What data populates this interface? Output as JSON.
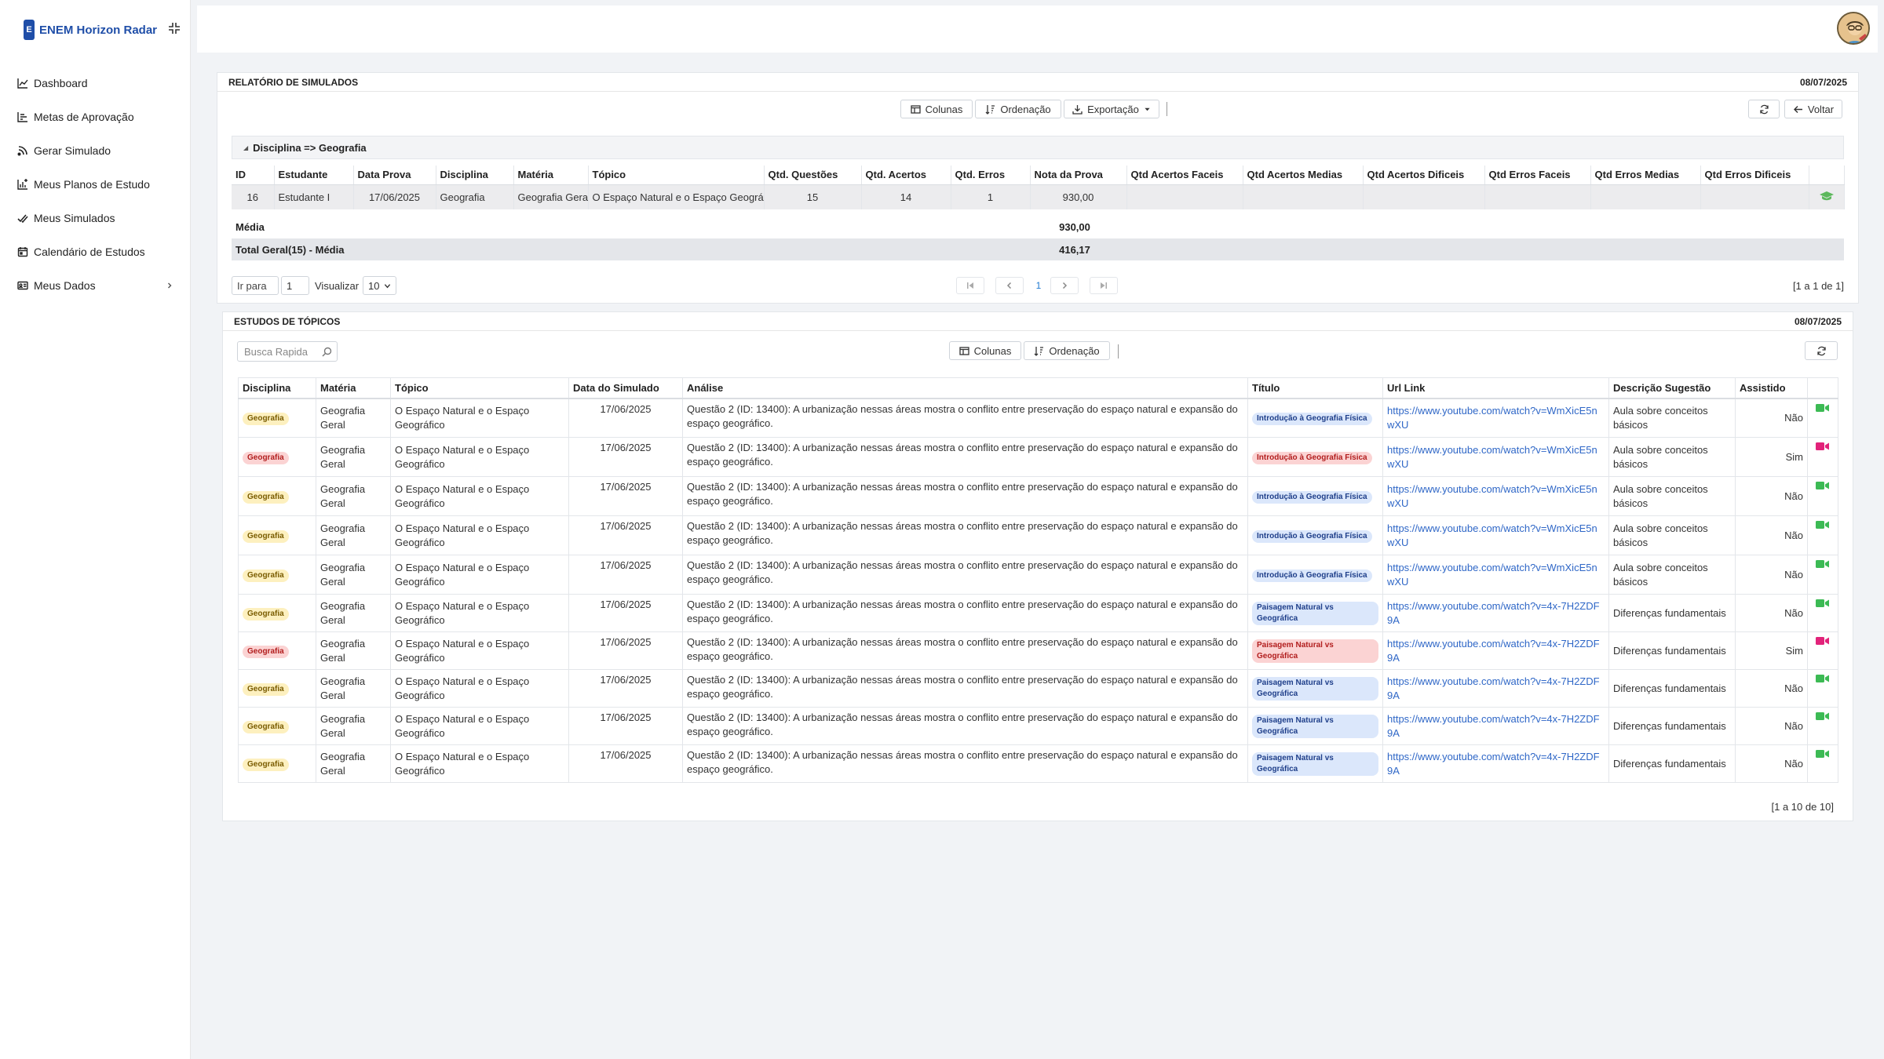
{
  "brand": {
    "badge": "E",
    "name": "ENEM Horizon Radar"
  },
  "nav": [
    {
      "label": "Dashboard",
      "icon": "line-chart-icon"
    },
    {
      "label": "Metas de Aprovação",
      "icon": "bar-chart-icon"
    },
    {
      "label": "Gerar Simulado",
      "icon": "rss-icon"
    },
    {
      "label": "Meus Planos de Estudo",
      "icon": "chart-plan-icon"
    },
    {
      "label": "Meus Simulados",
      "icon": "check-double-icon"
    },
    {
      "label": "Calendário de Estudos",
      "icon": "calendar-icon"
    },
    {
      "label": "Meus Dados",
      "icon": "id-card-icon"
    }
  ],
  "report": {
    "title": "RELATÓRIO DE SIMULADOS",
    "date": "08/07/2025",
    "buttons": {
      "columns": "Colunas",
      "order": "Ordenação",
      "export": "Exportação",
      "back": "Voltar"
    },
    "group_label": "Disciplina => Geografia",
    "columns": [
      "ID",
      "Estudante",
      "Data Prova",
      "Disciplina",
      "Matéria",
      "Tópico",
      "Qtd. Questões",
      "Qtd. Acertos",
      "Qtd. Erros",
      "Nota da Prova",
      "Qtd Acertos Faceis",
      "Qtd Acertos Medias",
      "Qtd Acertos Dificeis",
      "Qtd Erros Faceis",
      "Qtd Erros Medias",
      "Qtd Erros Dificeis"
    ],
    "row": {
      "id": "16",
      "student": "Estudante I",
      "date": "17/06/2025",
      "discipline": "Geografia",
      "subject": "Geografia Geral",
      "topic": "O Espaço Natural e o Espaço Geográfico",
      "questions": "15",
      "hits": "14",
      "errors": "1",
      "score": "930,00"
    },
    "avg_label": "Média",
    "avg_value": "930,00",
    "total_label": "Total Geral(15) - Média",
    "total_value": "416,17",
    "goto_label": "Ir para",
    "goto_value": "1",
    "view_label": "Visualizar",
    "view_value": "10",
    "current_page": "1",
    "range": "[1 a 1 de 1]"
  },
  "topics": {
    "title": "ESTUDOS DE TÓPICOS",
    "date": "08/07/2025",
    "search_placeholder": "Busca Rapida",
    "buttons": {
      "columns": "Colunas",
      "order": "Ordenação"
    },
    "columns": [
      "Disciplina",
      "Matéria",
      "Tópico",
      "Data do Simulado",
      "Análise",
      "Título",
      "Url Link",
      "Descrição Sugestão",
      "Assistido"
    ],
    "rows": [
      {
        "discipline": "Geografia",
        "d_color": "yellow",
        "subject": "Geografia Geral",
        "topic": "O Espaço Natural e o Espaço Geográfico",
        "date": "17/06/2025",
        "analysis": "Questão 2 (ID: 13400): A urbanização nessas áreas mostra o conflito entre preservação do espaço natural e expansão do espaço geográfico.",
        "title": "Introdução à Geografia Física",
        "t_color": "blue",
        "url": "https://www.youtube.com/watch?v=WmXicE5nwXU",
        "desc": "Aula sobre conceitos básicos",
        "watched": "Não",
        "cam": "green"
      },
      {
        "discipline": "Geografia",
        "d_color": "red",
        "subject": "Geografia Geral",
        "topic": "O Espaço Natural e o Espaço Geográfico",
        "date": "17/06/2025",
        "analysis": "Questão 2 (ID: 13400): A urbanização nessas áreas mostra o conflito entre preservação do espaço natural e expansão do espaço geográfico.",
        "title": "Introdução à Geografia Física",
        "t_color": "red",
        "url": "https://www.youtube.com/watch?v=WmXicE5nwXU",
        "desc": "Aula sobre conceitos básicos",
        "watched": "Sim",
        "cam": "pink"
      },
      {
        "discipline": "Geografia",
        "d_color": "yellow",
        "subject": "Geografia Geral",
        "topic": "O Espaço Natural e o Espaço Geográfico",
        "date": "17/06/2025",
        "analysis": "Questão 2 (ID: 13400): A urbanização nessas áreas mostra o conflito entre preservação do espaço natural e expansão do espaço geográfico.",
        "title": "Introdução à Geografia Física",
        "t_color": "blue",
        "url": "https://www.youtube.com/watch?v=WmXicE5nwXU",
        "desc": "Aula sobre conceitos básicos",
        "watched": "Não",
        "cam": "green"
      },
      {
        "discipline": "Geografia",
        "d_color": "yellow",
        "subject": "Geografia Geral",
        "topic": "O Espaço Natural e o Espaço Geográfico",
        "date": "17/06/2025",
        "analysis": "Questão 2 (ID: 13400): A urbanização nessas áreas mostra o conflito entre preservação do espaço natural e expansão do espaço geográfico.",
        "title": "Introdução à Geografia Física",
        "t_color": "blue",
        "url": "https://www.youtube.com/watch?v=WmXicE5nwXU",
        "desc": "Aula sobre conceitos básicos",
        "watched": "Não",
        "cam": "green"
      },
      {
        "discipline": "Geografia",
        "d_color": "yellow",
        "subject": "Geografia Geral",
        "topic": "O Espaço Natural e o Espaço Geográfico",
        "date": "17/06/2025",
        "analysis": "Questão 2 (ID: 13400): A urbanização nessas áreas mostra o conflito entre preservação do espaço natural e expansão do espaço geográfico.",
        "title": "Introdução à Geografia Física",
        "t_color": "blue",
        "url": "https://www.youtube.com/watch?v=WmXicE5nwXU",
        "desc": "Aula sobre conceitos básicos",
        "watched": "Não",
        "cam": "green"
      },
      {
        "discipline": "Geografia",
        "d_color": "yellow",
        "subject": "Geografia Geral",
        "topic": "O Espaço Natural e o Espaço Geográfico",
        "date": "17/06/2025",
        "analysis": "Questão 2 (ID: 13400): A urbanização nessas áreas mostra o conflito entre preservação do espaço natural e expansão do espaço geográfico.",
        "title": "Paisagem Natural vs Geográfica",
        "t_color": "blue",
        "url": "https://www.youtube.com/watch?v=4x-7H2ZDF9A",
        "desc": "Diferenças fundamentais",
        "watched": "Não",
        "cam": "green"
      },
      {
        "discipline": "Geografia",
        "d_color": "red",
        "subject": "Geografia Geral",
        "topic": "O Espaço Natural e o Espaço Geográfico",
        "date": "17/06/2025",
        "analysis": "Questão 2 (ID: 13400): A urbanização nessas áreas mostra o conflito entre preservação do espaço natural e expansão do espaço geográfico.",
        "title": "Paisagem Natural vs Geográfica",
        "t_color": "red",
        "url": "https://www.youtube.com/watch?v=4x-7H2ZDF9A",
        "desc": "Diferenças fundamentais",
        "watched": "Sim",
        "cam": "pink"
      },
      {
        "discipline": "Geografia",
        "d_color": "yellow",
        "subject": "Geografia Geral",
        "topic": "O Espaço Natural e o Espaço Geográfico",
        "date": "17/06/2025",
        "analysis": "Questão 2 (ID: 13400): A urbanização nessas áreas mostra o conflito entre preservação do espaço natural e expansão do espaço geográfico.",
        "title": "Paisagem Natural vs Geográfica",
        "t_color": "blue",
        "url": "https://www.youtube.com/watch?v=4x-7H2ZDF9A",
        "desc": "Diferenças fundamentais",
        "watched": "Não",
        "cam": "green"
      },
      {
        "discipline": "Geografia",
        "d_color": "yellow",
        "subject": "Geografia Geral",
        "topic": "O Espaço Natural e o Espaço Geográfico",
        "date": "17/06/2025",
        "analysis": "Questão 2 (ID: 13400): A urbanização nessas áreas mostra o conflito entre preservação do espaço natural e expansão do espaço geográfico.",
        "title": "Paisagem Natural vs Geográfica",
        "t_color": "blue",
        "url": "https://www.youtube.com/watch?v=4x-7H2ZDF9A",
        "desc": "Diferenças fundamentais",
        "watched": "Não",
        "cam": "green"
      },
      {
        "discipline": "Geografia",
        "d_color": "yellow",
        "subject": "Geografia Geral",
        "topic": "O Espaço Natural e o Espaço Geográfico",
        "date": "17/06/2025",
        "analysis": "Questão 2 (ID: 13400): A urbanização nessas áreas mostra o conflito entre preservação do espaço natural e expansão do espaço geográfico.",
        "title": "Paisagem Natural vs Geográfica",
        "t_color": "blue",
        "url": "https://www.youtube.com/watch?v=4x-7H2ZDF9A",
        "desc": "Diferenças fundamentais",
        "watched": "Não",
        "cam": "green"
      }
    ],
    "range": "[1 a 10 de 10]"
  },
  "colors": {
    "brand": "#1f4ea8",
    "link": "#2f67c7",
    "cam_green": "#3cba54",
    "cam_pink": "#e2237a",
    "study_icon": "#5cb85c"
  }
}
